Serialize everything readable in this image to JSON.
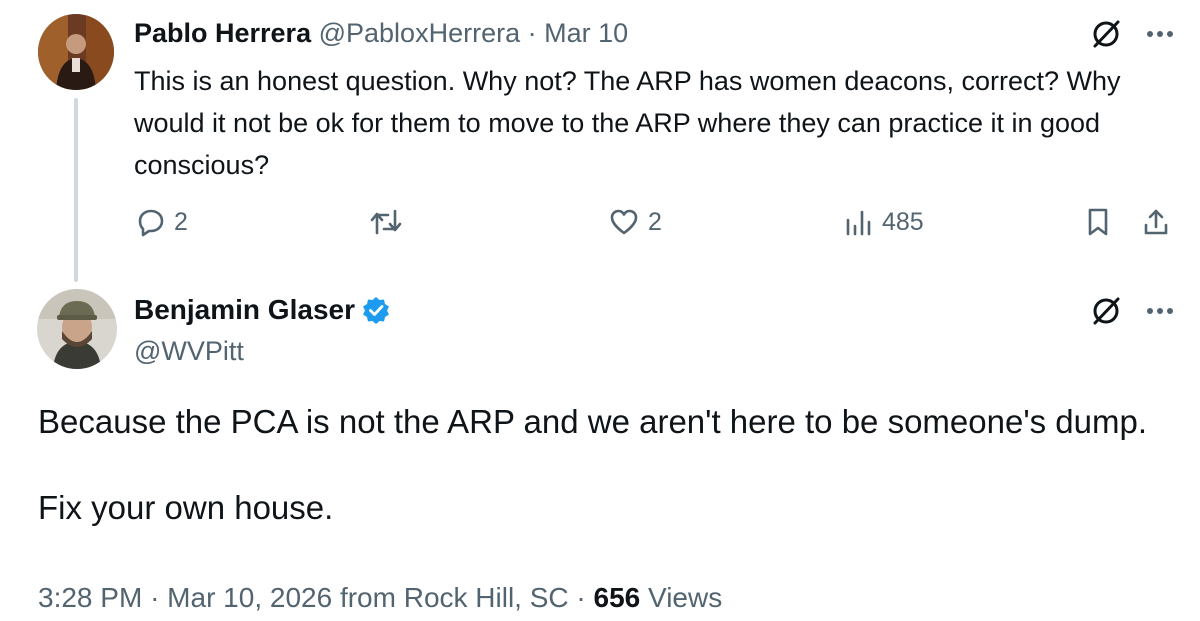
{
  "reply": {
    "author_name": "Pablo Herrera",
    "author_handle": "@PabloxHerrera",
    "separator": "·",
    "date": "Mar 10",
    "text": "This is an honest question. Why not? The ARP has women deacons, correct? Why would it not be ok for them to move to the ARP where they can practice it in good conscious?",
    "replies_count": "2",
    "likes_count": "2",
    "views_count": "485"
  },
  "main_post": {
    "author_name": "Benjamin Glaser",
    "author_handle": "@WVPitt",
    "paragraphs": [
      "Because the PCA is not the ARP and we aren't here to be someone's dump.",
      "Fix your own house."
    ],
    "meta": {
      "time": "3:28 PM",
      "separator": "·",
      "date": "Mar 10, 2026 from Rock Hill, SC",
      "separator2": "·",
      "views_count": "656",
      "views_label": "Views"
    }
  },
  "icons": {
    "grok": "grok-icon",
    "more": "more-icon",
    "reply": "reply-icon",
    "retweet": "retweet-icon",
    "like": "heart-icon",
    "views": "views-icon",
    "bookmark": "bookmark-icon",
    "share": "share-icon",
    "verified": "verified-badge-icon"
  },
  "colors": {
    "text": "#0f1419",
    "secondary": "#536471",
    "verified_blue": "#1d9bf0",
    "thread_line": "#cfd9de"
  }
}
